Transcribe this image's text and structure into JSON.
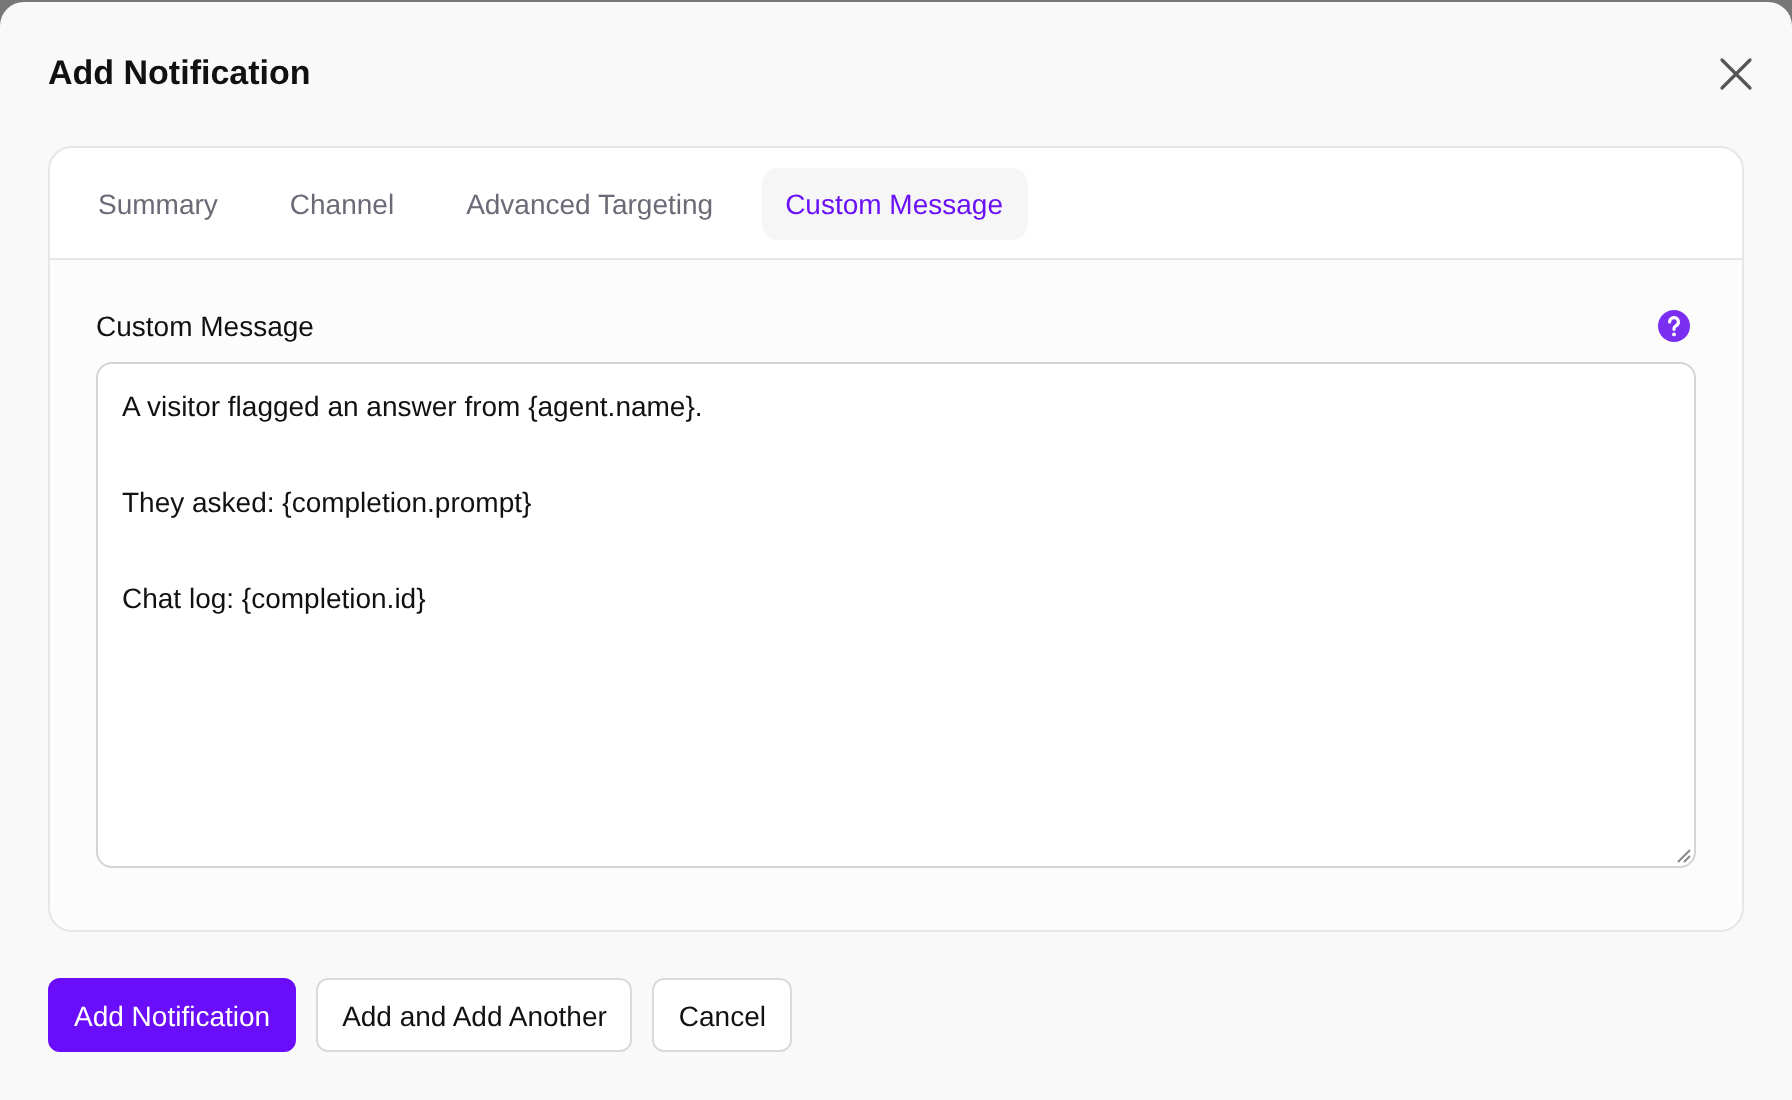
{
  "dialog": {
    "title": "Add Notification"
  },
  "tabs": [
    {
      "label": "Summary",
      "selected": false
    },
    {
      "label": "Channel",
      "selected": false
    },
    {
      "label": "Advanced Targeting",
      "selected": false
    },
    {
      "label": "Custom Message",
      "selected": true
    }
  ],
  "message_field": {
    "label": "Custom Message",
    "value": "A visitor flagged an answer from {agent.name}.\n\nThey asked: {completion.prompt}\n\nChat log: {completion.id}"
  },
  "buttons": [
    {
      "label": "Add Notification",
      "kind": "primary"
    },
    {
      "label": "Add and Add Another",
      "kind": "secondary"
    },
    {
      "label": "Cancel",
      "kind": "secondary"
    }
  ]
}
